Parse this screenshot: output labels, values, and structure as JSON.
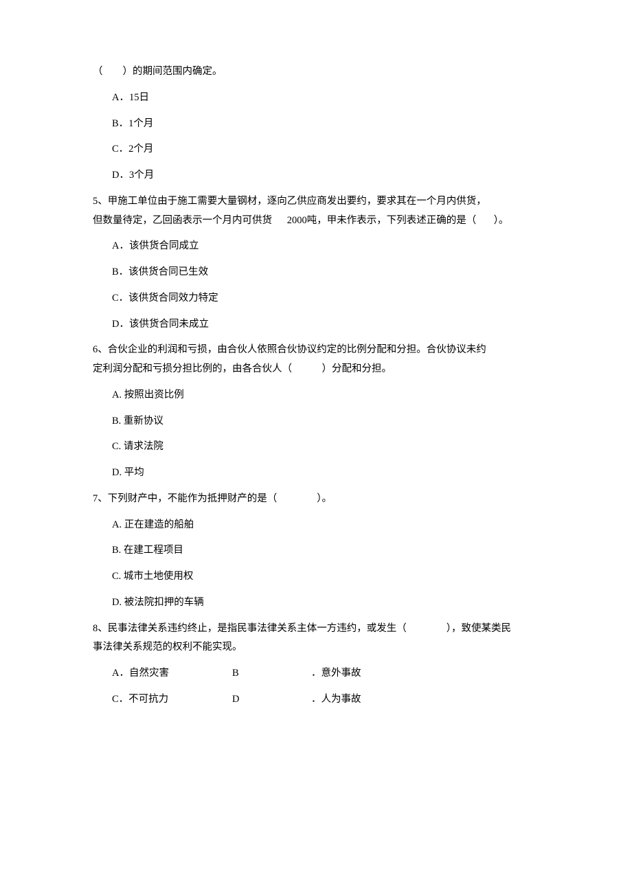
{
  "q4": {
    "stem_tail": "（　　）的期间范围内确定。",
    "options": {
      "a": "A．15日",
      "b": "B．1个月",
      "c": "C．2个月",
      "d": "D．3个月"
    }
  },
  "q5": {
    "stem_line1": "5、甲施工单位由于施工需要大量钢材，逐向乙供应商发出要约，要求其在一个月内供货，",
    "stem_line2_a": "但数量待定，乙回函表示一个月内可供货",
    "stem_line2_b": "2000吨，甲未作表示，下列表述正确的是（",
    "stem_line2_c": "）。",
    "options": {
      "a": "A．该供货合同成立",
      "b": "B．该供货合同已生效",
      "c": "C．该供货合同效力特定",
      "d": "D．该供货合同未成立"
    }
  },
  "q6": {
    "stem_line1": "6、合伙企业的利润和亏损，由合伙人依照合伙协议约定的比例分配和分担。合伙协议未约",
    "stem_line2": "定利润分配和亏损分担比例的，由各合伙人（　　　）分配和分担。",
    "options": {
      "a": "A. 按照出资比例",
      "b": "B. 重新协议",
      "c": "C. 请求法院",
      "d": "D. 平均"
    }
  },
  "q7": {
    "stem": "7、下列财产中，不能作为抵押财产的是（　　　　）。",
    "options": {
      "a": "A. 正在建造的船舶",
      "b": "B. 在建工程项目",
      "c": "C. 城市土地使用权",
      "d": "D. 被法院扣押的车辆"
    }
  },
  "q8": {
    "stem_line1": "8、民事法律关系违约终止，是指民事法律关系主体一方违约，或发生（　　　　），致使某类民",
    "stem_line2": "事法律关系规范的权利不能实现。",
    "options": {
      "a": "A．自然灾害",
      "b_letter": "B",
      "b_text": "．意外事故",
      "c": "C．不可抗力",
      "d_letter": "D",
      "d_text": "．人为事故"
    }
  }
}
